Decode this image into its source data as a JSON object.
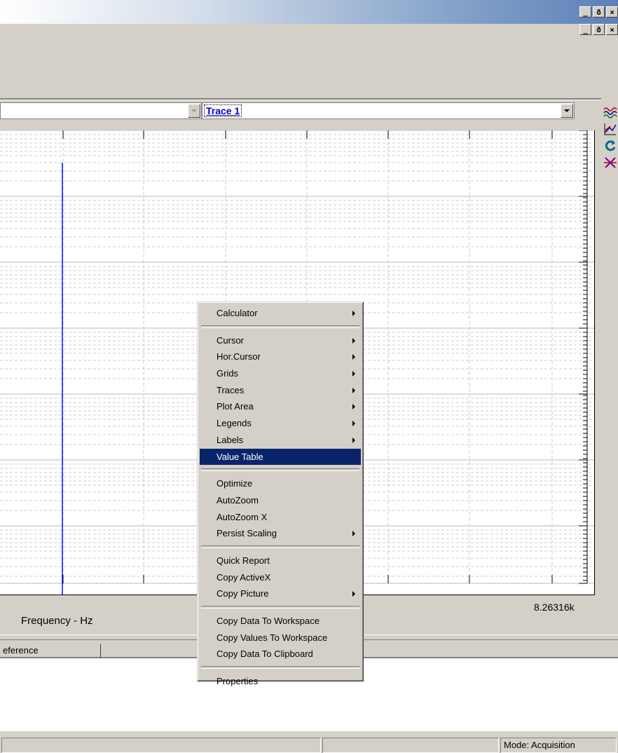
{
  "trace_selector": {
    "value": "Trace 1"
  },
  "window_controls": {
    "minimize": "_",
    "restore": "ð",
    "close": "×"
  },
  "right_toolbar": [
    "waveform-icon",
    "graph-icon",
    "refresh-icon",
    "tool-icon"
  ],
  "plot": {
    "x_axis_label": "Frequency - Hz",
    "x_max_label": "8.26316k",
    "trace_color": "#0000ff"
  },
  "context_menu": {
    "groups": [
      [
        {
          "label": "Calculator",
          "submenu": true
        }
      ],
      [
        {
          "label": "Cursor",
          "submenu": true
        },
        {
          "label": "Hor.Cursor",
          "submenu": true
        },
        {
          "label": "Grids",
          "submenu": true
        },
        {
          "label": "Traces",
          "submenu": true
        },
        {
          "label": "Plot Area",
          "submenu": true
        },
        {
          "label": "Legends",
          "submenu": true
        },
        {
          "label": "Labels",
          "submenu": true
        },
        {
          "label": "Value Table",
          "submenu": false,
          "selected": true
        }
      ],
      [
        {
          "label": "Optimize",
          "submenu": false
        },
        {
          "label": "AutoZoom",
          "submenu": false
        },
        {
          "label": "AutoZoom X",
          "submenu": false
        },
        {
          "label": "Persist Scaling",
          "submenu": true
        }
      ],
      [
        {
          "label": "Quick Report",
          "submenu": false
        },
        {
          "label": "Copy ActiveX",
          "submenu": false
        },
        {
          "label": "Copy Picture",
          "submenu": true
        }
      ],
      [
        {
          "label": "Copy Data To Workspace",
          "submenu": false
        },
        {
          "label": "Copy Values To Workspace",
          "submenu": false
        },
        {
          "label": "Copy Data To Clipboard",
          "submenu": false
        }
      ],
      [
        {
          "label": "Properties",
          "submenu": false
        }
      ]
    ]
  },
  "table": {
    "columns": [
      "eference",
      ""
    ]
  },
  "status_bar": {
    "panels": [
      "",
      "",
      "Mode: Acquisition"
    ]
  },
  "colors": {
    "selection": "#0a246a",
    "chrome": "#d4d0c8"
  }
}
